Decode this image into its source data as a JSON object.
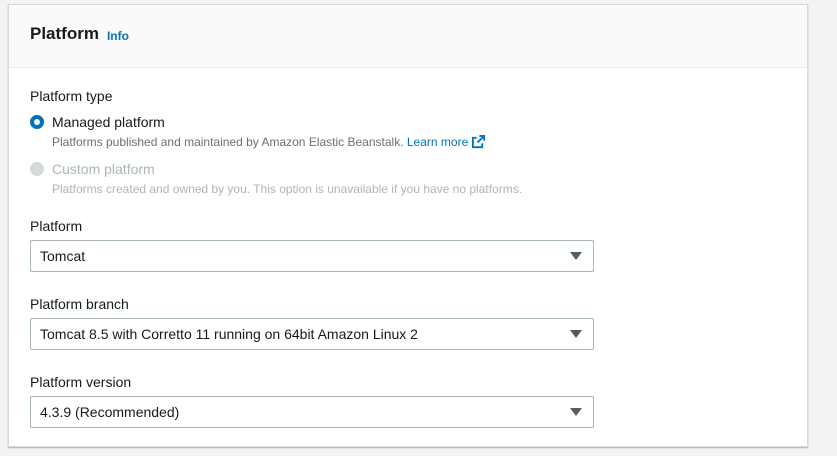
{
  "header": {
    "title": "Platform",
    "info_label": "Info"
  },
  "platform_type": {
    "label": "Platform type",
    "options": [
      {
        "label": "Managed platform",
        "description": "Platforms published and maintained by Amazon Elastic Beanstalk.",
        "link": "Learn more",
        "selected": true,
        "disabled": false
      },
      {
        "label": "Custom platform",
        "description": "Platforms created and owned by you. This option is unavailable if you have no platforms.",
        "selected": false,
        "disabled": true
      }
    ]
  },
  "platform": {
    "label": "Platform",
    "value": "Tomcat"
  },
  "platform_branch": {
    "label": "Platform branch",
    "value": "Tomcat 8.5 with Corretto 11 running on 64bit Amazon Linux 2"
  },
  "platform_version": {
    "label": "Platform version",
    "value": "4.3.9 (Recommended)"
  },
  "colors": {
    "accent": "#0073bb",
    "disabled": "#aab7b8",
    "text": "#16191f",
    "secondary_text": "#687078"
  }
}
